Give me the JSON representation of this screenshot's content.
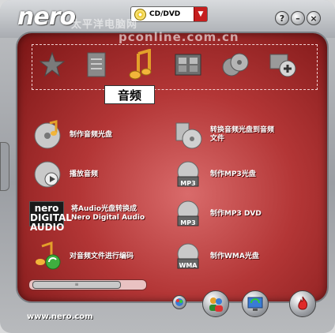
{
  "app": {
    "logo": "nero",
    "mode": "CD/DVD",
    "url": "www.nero.com"
  },
  "watermark": {
    "line1": "太平洋电脑网",
    "line2": "pconline.com.cn"
  },
  "window_buttons": {
    "help": "?",
    "minimize": "–",
    "close": "×"
  },
  "category": {
    "selected_label": "音频"
  },
  "categories": [
    "favorites-star-icon",
    "documents-icon",
    "audio-note-icon",
    "video-film-icon",
    "copy-discs-icon",
    "extras-plus-icon"
  ],
  "tasks": [
    {
      "label": "制作音频光盘",
      "icon": "audio-disc-icon"
    },
    {
      "label": "转换音频光盘到音频\n文件",
      "icon": "convert-audio-icon"
    },
    {
      "label": "播放音频",
      "icon": "play-audio-icon"
    },
    {
      "label": "制作MP3光盘",
      "icon": "mp3-disc-icon"
    },
    {
      "label": "将Audio光盘转换成\nNero Digital Audio",
      "icon": "nero-digital-audio-icon"
    },
    {
      "label": "制作MP3 DVD",
      "icon": "mp3-dvd-icon"
    },
    {
      "label": "对音频文件进行编码",
      "icon": "encode-audio-icon"
    },
    {
      "label": "制作WMA光盘",
      "icon": "wma-disc-icon"
    }
  ],
  "nero_digital_label": "nero\nDIGITAL AUDIO",
  "disc_labels": {
    "mp3": "MP3",
    "wma": "WMA"
  },
  "colors": {
    "panel_red": "#b33636",
    "mode_dropdown": "#c61e1e"
  }
}
